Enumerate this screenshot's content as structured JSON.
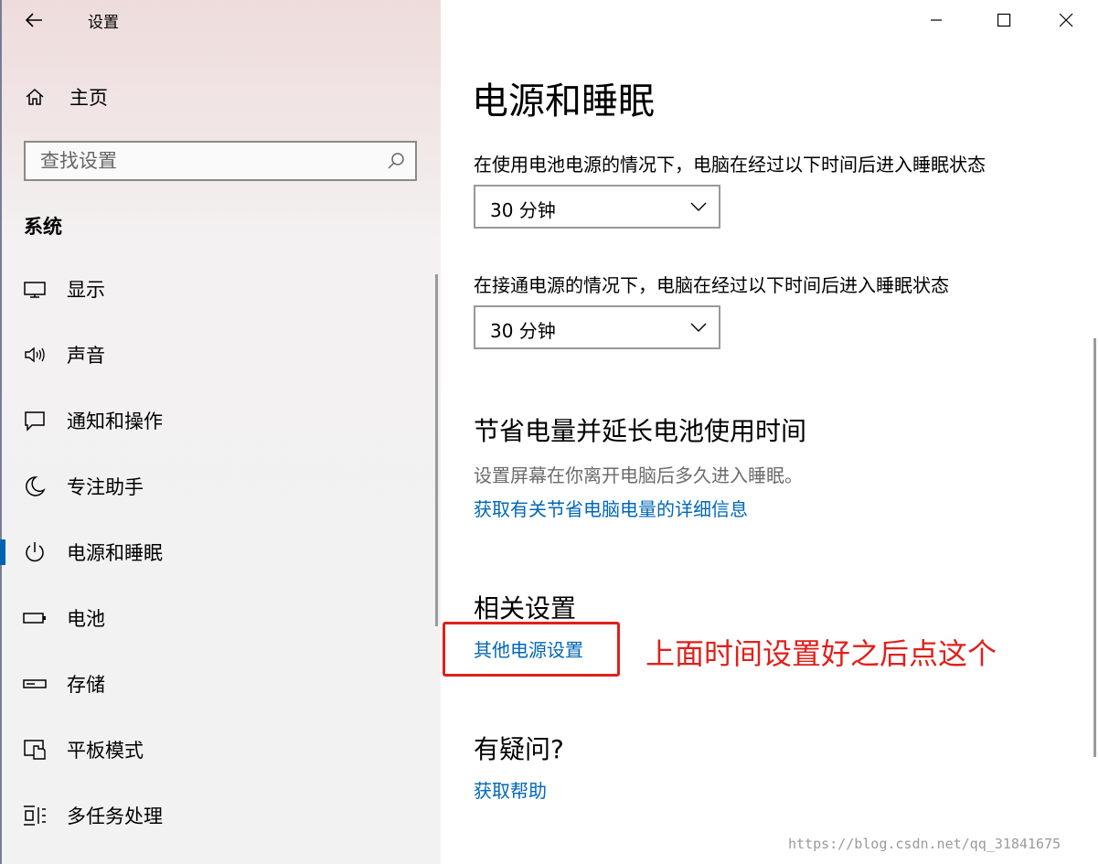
{
  "window": {
    "title": "设置"
  },
  "sidebar": {
    "home_label": "主页",
    "search_placeholder": "查找设置",
    "section_heading": "系统",
    "items": [
      {
        "label": "显示",
        "icon": "monitor-icon"
      },
      {
        "label": "声音",
        "icon": "speaker-icon"
      },
      {
        "label": "通知和操作",
        "icon": "notification-icon"
      },
      {
        "label": "专注助手",
        "icon": "moon-icon"
      },
      {
        "label": "电源和睡眠",
        "icon": "power-icon",
        "selected": true
      },
      {
        "label": "电池",
        "icon": "battery-icon"
      },
      {
        "label": "存储",
        "icon": "storage-icon"
      },
      {
        "label": "平板模式",
        "icon": "tablet-mode-icon"
      },
      {
        "label": "多任务处理",
        "icon": "multitask-icon"
      }
    ]
  },
  "main": {
    "title": "电源和睡眠",
    "battery_desc": "在使用电池电源的情况下，电脑在经过以下时间后进入睡眠状态",
    "battery_value": "30 分钟",
    "plugged_desc": "在接通电源的情况下，电脑在经过以下时间后进入睡眠状态",
    "plugged_value": "30 分钟",
    "save_heading": "节省电量并延长电池使用时间",
    "save_desc": "设置屏幕在你离开电脑后多久进入睡眠。",
    "save_link": "获取有关节省电脑电量的详细信息",
    "related_heading": "相关设置",
    "related_link": "其他电源设置",
    "annotation": "上面时间设置好之后点这个",
    "question_heading": "有疑问?",
    "help_link": "获取帮助"
  },
  "watermark": "https://blog.csdn.net/qq_31841675",
  "colors": {
    "accent": "#0063b1",
    "link": "#0067b8",
    "annotation": "#e0201b"
  }
}
